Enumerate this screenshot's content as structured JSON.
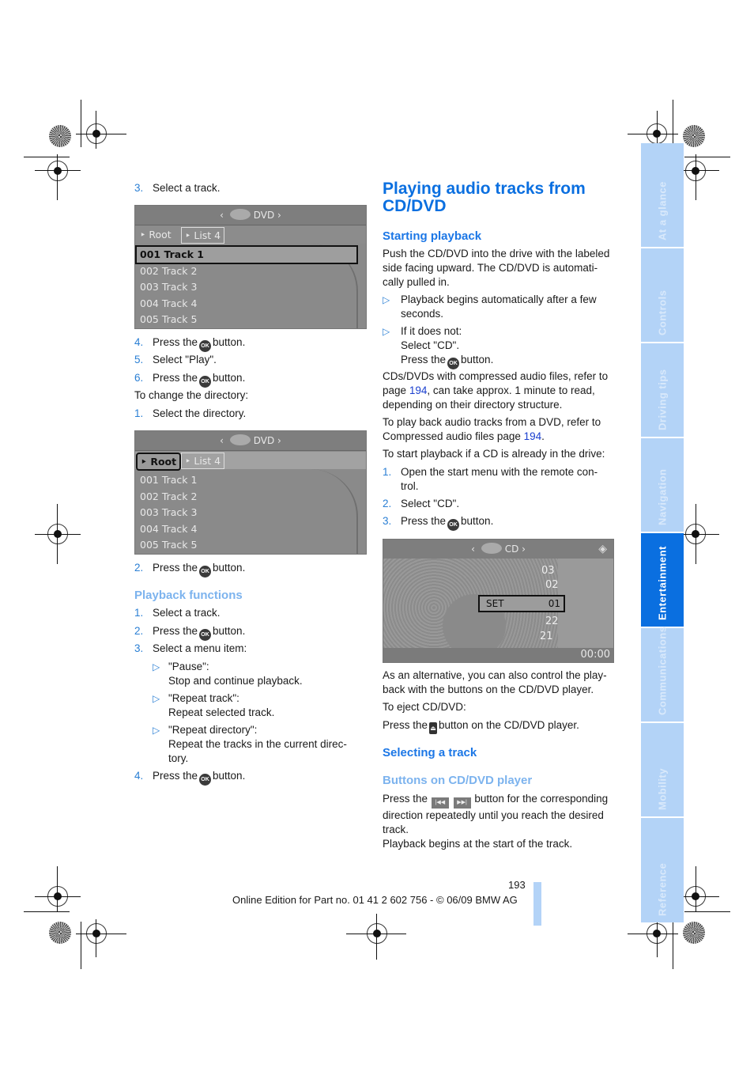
{
  "left": {
    "step3": {
      "num": "3.",
      "text": "Select a track."
    },
    "screen1": {
      "source": "DVD",
      "crumbs": [
        "Root",
        "List 4"
      ],
      "tracks": [
        "001 Track 1",
        "002 Track 2",
        "003 Track 3",
        "004 Track 4",
        "005 Track 5"
      ],
      "selected_track": "001 Track 1"
    },
    "steps_a": [
      {
        "num": "4.",
        "pre": "Press the",
        "icon": "OK",
        "post": "button."
      },
      {
        "num": "5.",
        "pre": "Select \"Play\".",
        "icon": "",
        "post": ""
      },
      {
        "num": "6.",
        "pre": "Press the",
        "icon": "OK",
        "post": "button."
      }
    ],
    "change_dir": "To change the directory:",
    "step_dir1": {
      "num": "1.",
      "text": "Select the directory."
    },
    "screen2": {
      "source": "DVD",
      "crumbs": [
        "Root",
        "List 4"
      ],
      "selected_crumb": "Root",
      "tracks": [
        "001 Track 1",
        "002 Track 2",
        "003 Track 3",
        "004 Track 4",
        "005 Track 5"
      ]
    },
    "step_dir2": {
      "num": "2.",
      "pre": "Press the",
      "icon": "OK",
      "post": "button."
    },
    "playback_functions": {
      "heading": "Playback functions",
      "steps": [
        {
          "num": "1.",
          "text": "Select a track."
        },
        {
          "num": "2.",
          "pre": "Press the",
          "icon": "OK",
          "post": "button."
        },
        {
          "num": "3.",
          "text": "Select a menu item:"
        }
      ],
      "options": [
        {
          "label": "\"Pause\":",
          "desc": "Stop and continue playback."
        },
        {
          "label": "\"Repeat track\":",
          "desc": "Repeat selected track."
        },
        {
          "label": "\"Repeat directory\":",
          "desc": "Repeat the tracks in the current direc-",
          "desc2": "tory."
        }
      ],
      "step4": {
        "num": "4.",
        "pre": "Press the",
        "icon": "OK",
        "post": "button."
      }
    }
  },
  "right": {
    "title_line1": "Playing audio tracks from",
    "title_line2": "CD/DVD",
    "starting": {
      "heading": "Starting playback",
      "para": [
        "Push the CD/DVD into the drive with the labeled",
        "side facing upward. The CD/DVD is automati-",
        "cally pulled in."
      ],
      "bullet1": [
        "Playback begins automatically after a few",
        "seconds."
      ],
      "bullet2": {
        "l1": "If it does not:",
        "l2": "Select \"CD\".",
        "l3pre": "Press the",
        "icon": "OK",
        "l3post": "button."
      },
      "para2": {
        "l1": "CDs/DVDs with compressed audio files, refer to",
        "l2pre": "page",
        "l2link": "194",
        "l2post": ", can take approx. 1 minute to read,",
        "l3": "depending on their directory structure."
      },
      "para3": {
        "l1": "To play back audio tracks from a DVD, refer to",
        "l2pre": "Compressed audio files page",
        "l2link": "194",
        "l2post": "."
      },
      "para4": "To start playback if a CD is already in the drive:",
      "steps": [
        {
          "num": "1.",
          "l1": "Open the start menu with the remote con-",
          "l2": "trol."
        },
        {
          "num": "2.",
          "l1": "Select \"CD\"."
        },
        {
          "num": "3.",
          "pre": "Press the",
          "icon": "OK",
          "post": "button."
        }
      ]
    },
    "cd_screen": {
      "source": "CD",
      "set_label": "SET",
      "tracks_above": [
        "03",
        "02"
      ],
      "selected_track": "01",
      "tracks_below": [
        "22",
        "21"
      ],
      "time": "00:00"
    },
    "alt": [
      "As an alternative, you can also control the play-",
      "back with the buttons on the CD/DVD player."
    ],
    "eject_label": "To eject CD/DVD:",
    "eject": {
      "pre": "Press the",
      "icon": "eject",
      "post": "button on the CD/DVD player."
    },
    "selecting": {
      "heading": "Selecting a track",
      "subheading": "Buttons on CD/DVD player",
      "l1pre": "Press the",
      "btn_prev": "|◀◀",
      "btn_next": "▶▶|",
      "l1post": "button for the corresponding",
      "l2": "direction repeatedly until you reach the desired",
      "l3": "track.",
      "l4": "Playback begins at the start of the track."
    }
  },
  "side_tabs": [
    {
      "label": "At a glance",
      "active": false
    },
    {
      "label": "Controls",
      "active": false
    },
    {
      "label": "Driving tips",
      "active": false
    },
    {
      "label": "Navigation",
      "active": false
    },
    {
      "label": "Entertainment",
      "active": true
    },
    {
      "label": "Communications",
      "active": false
    },
    {
      "label": "Mobility",
      "active": false
    },
    {
      "label": "Reference",
      "active": false
    }
  ],
  "footer": {
    "page_number": "193",
    "edition": "Online Edition for Part no. 01 41 2 602 756 - © 06/09 BMW AG"
  },
  "colors": {
    "accent": "#0a6fe0",
    "tab_inactive": "#b3d3f7",
    "subheading_light": "#7cb3ee",
    "link": "#1a3fcf"
  }
}
